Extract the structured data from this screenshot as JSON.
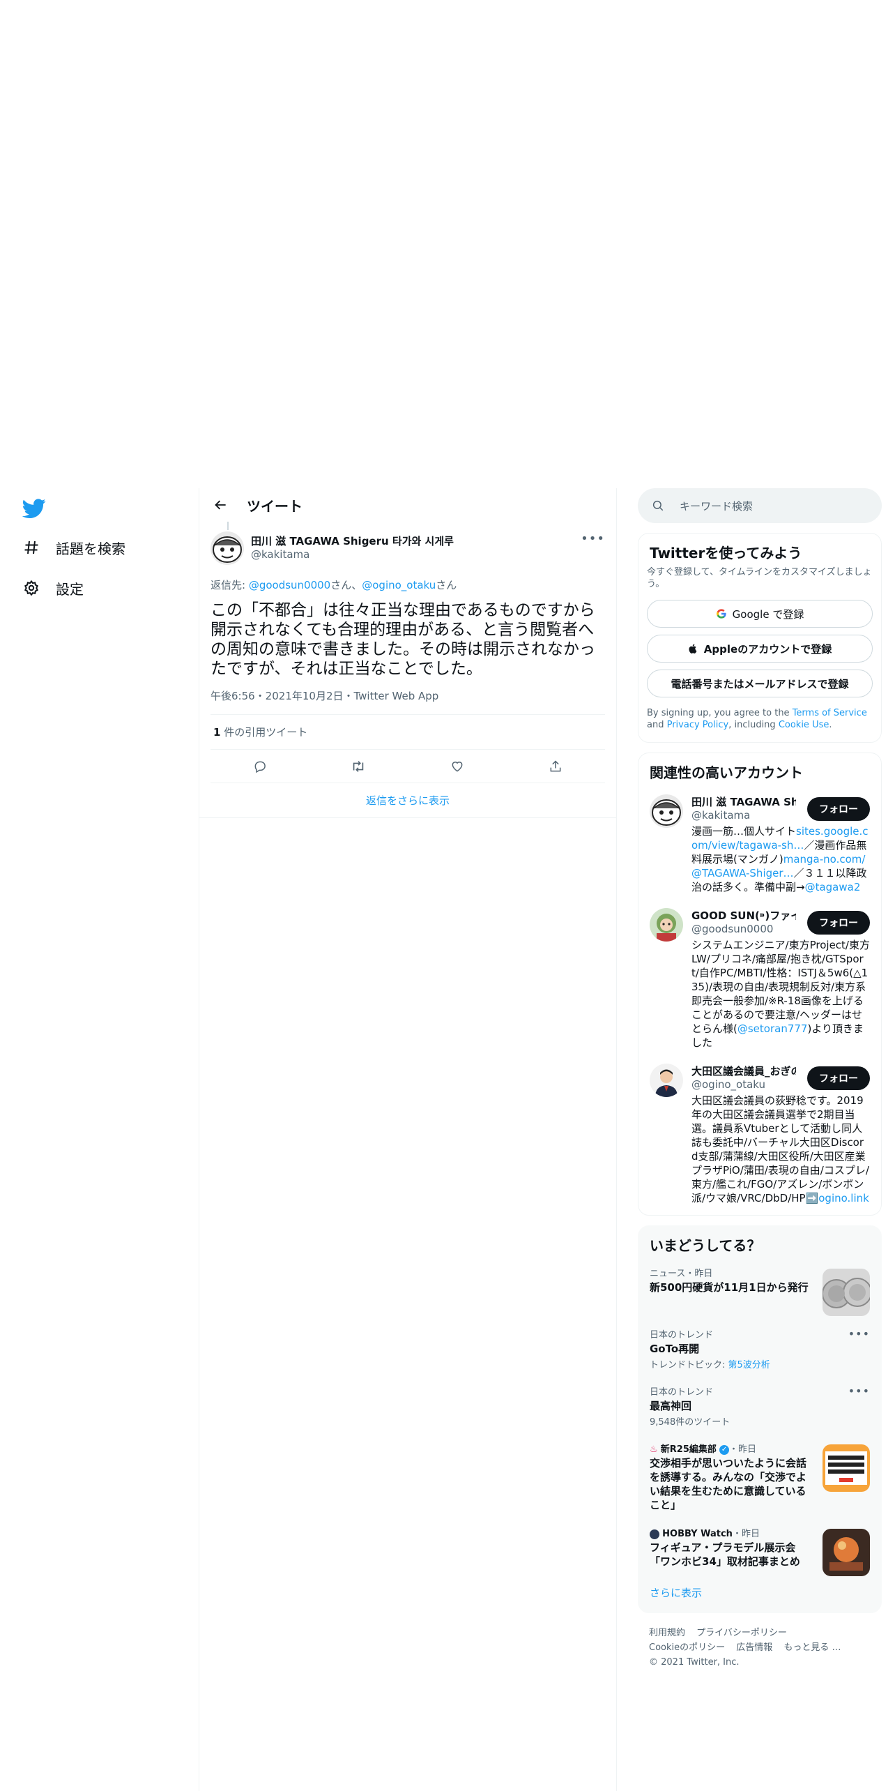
{
  "nav": {
    "items": [
      {
        "label": "話題を検索",
        "icon": "hashtag-icon"
      },
      {
        "label": "設定",
        "icon": "gear-icon"
      }
    ]
  },
  "main": {
    "title": "ツイート",
    "tweet": {
      "author_name": "田川 滋 TAGAWA Shigeru 타가와 시게루",
      "author_handle": "@kakitama",
      "reply_prefix": "返信先: ",
      "reply_user1": "@goodsun0000",
      "reply_san1": "さん、",
      "reply_user2": "@ogino_otaku",
      "reply_san2": "さん",
      "text": "この「不都合」は往々正当な理由であるものですから開示されなくても合理的理由がある、と言う閲覧者への周知の意味で書きました。その時は開示されなかったですが、それは正当なことでした。",
      "meta": "午後6:56・2021年10月2日・Twitter Web App",
      "quote_count": "1",
      "quote_label": " 件の引用ツイート"
    },
    "more_replies": "返信をさらに表示"
  },
  "right": {
    "search_placeholder": "キーワード検索",
    "signup": {
      "title": "Twitterを使ってみよう",
      "desc": "今すぐ登録して、タイムラインをカスタマイズしましょう。",
      "google": "Google で登録",
      "apple": "Appleのアカウントで登録",
      "phone": "電話番号またはメールアドレスで登録",
      "terms_prefix": "By signing up, you agree to the ",
      "terms_link": "Terms of Service",
      "terms_and": " and ",
      "privacy_link": "Privacy Policy",
      "terms_including": ", including ",
      "cookie_link": "Cookie Use",
      "terms_end": "."
    },
    "related": {
      "title": "関連性の高いアカウント",
      "follow_label": "フォロー",
      "accounts": [
        {
          "name": "田川 滋 TAGAWA Shigeru",
          "handle": "@kakitama",
          "bio1": "漫画一筋…個人サイト",
          "bio_link1": "sites.google.com/view/tagawa-sh…",
          "bio2": "／漫画作品無料展示場(マンガノ)",
          "bio_link2": "manga-no.com/@TAGAWA-Shiger…",
          "bio3": "／３１１以降政治の話多く。準備中副→",
          "bio_link3": "@tagawa2"
        },
        {
          "name": "GOOD SUN(⁍)ファイナル",
          "handle": "@goodsun0000",
          "bio1": "システムエンジニア/東方Project/東方LW/プリコネ/痛部屋/抱き枕/GTSport/自作PC/MBTI/性格：ISTJ＆5w6(△135)/表現の自由/表現規制反対/東方系即売会一般参加/※R-18画像を上げることがあるので要注意/ヘッダーはせとらん様(",
          "bio_link1": "@setoran777",
          "bio2": ")より頂きました"
        },
        {
          "name": "大田区議会議員_おぎの稔",
          "handle": "@ogino_otaku",
          "bio1": "大田区議会議員の荻野稔です。2019年の大田区議会議員選挙で2期目当選。議員系Vtuberとして活動し同人誌も委託中/バーチャル大田区Discord支部/蒲蒲線/大田区役所/大田区産業プラザPiO/蒲田/表現の自由/コスプレ/東方/艦これ/FGO/アズレン/ボンボン派/ウマ娘/VRC/DbD/HP➡️",
          "bio_link1": "ogino.link"
        }
      ]
    },
    "trends": {
      "title": "いまどうしてる？",
      "items": [
        {
          "context": "ニュース・昨日",
          "title": "新500円硬貨が11月1日から発行"
        },
        {
          "context": "日本のトレンド",
          "title": "GoTo再開",
          "sub_prefix": "トレンドトピック: ",
          "sub_link": "第5波分析"
        },
        {
          "context": "日本のトレンド",
          "title": "最高神回",
          "sub": "9,548件のツイート"
        },
        {
          "context_source": "新R25編集部",
          "context_time": "・昨日",
          "title": "交渉相手が思いついたように会話を誘導する。みんなの「交渉でよい結果を生むために意識していること」"
        },
        {
          "context_source": "HOBBY Watch",
          "context_time": "・昨日",
          "title": "フィギュア・プラモデル展示会「ワンホビ34」取材記事まとめ"
        }
      ],
      "show_more": "さらに表示"
    },
    "footer": {
      "terms": "利用規約",
      "privacy": "プライバシーポリシー",
      "cookie": "Cookieのポリシー",
      "ads": "広告情報",
      "more": "もっと見る …",
      "copyright": "© 2021 Twitter, Inc."
    }
  },
  "colors": {
    "accent": "#1d9bf0",
    "text": "#0f1419",
    "muted": "#536471",
    "button_dark": "#0f1419"
  }
}
